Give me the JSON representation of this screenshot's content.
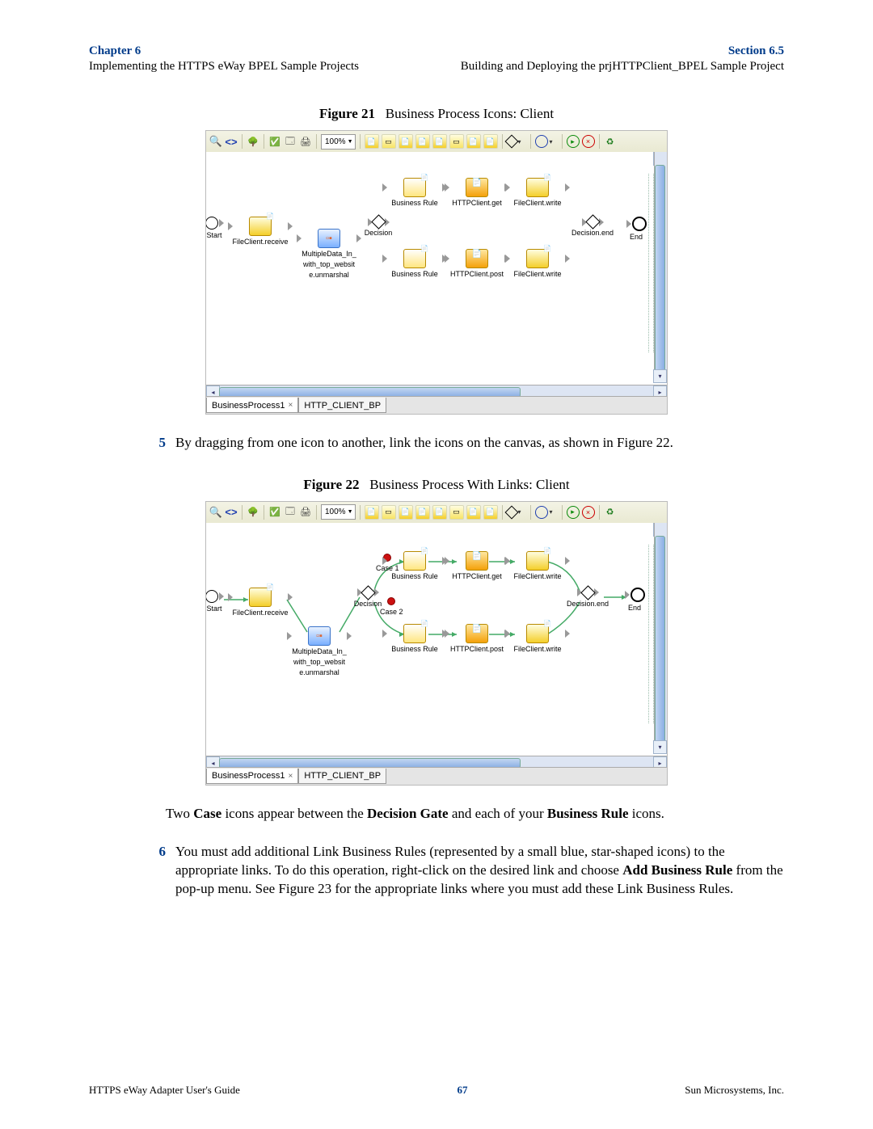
{
  "header": {
    "chapter_label": "Chapter 6",
    "chapter_sub": "Implementing the HTTPS eWay BPEL Sample Projects",
    "section_label": "Section 6.5",
    "section_sub": "Building and Deploying the prjHTTPClient_BPEL Sample Project"
  },
  "figure21": {
    "label": "Figure 21",
    "title": "Business Process Icons: Client",
    "toolbar": {
      "zoom": "100%"
    },
    "tabs": {
      "tab1": "BusinessProcess1",
      "tab2": "HTTP_CLIENT_BP"
    },
    "nodes": {
      "start": "Start",
      "fcr": "FileClient.receive",
      "multi1": "MultipleData_In_",
      "multi2": "with_top_websit",
      "multi3": "e.unmarshal",
      "decision": "Decision",
      "brule": "Business Rule",
      "httpget": "HTTPClient.get",
      "httppost": "HTTPClient.post",
      "fcw": "FileClient.write",
      "dend": "Decision.end",
      "end": "End"
    }
  },
  "para5": {
    "num": "5",
    "text": "By dragging from one icon to another, link the icons on the canvas, as shown in Figure 22."
  },
  "figure22": {
    "label": "Figure 22",
    "title": "Business Process With Links: Client",
    "toolbar": {
      "zoom": "100%"
    },
    "tabs": {
      "tab1": "BusinessProcess1",
      "tab2": "HTTP_CLIENT_BP"
    },
    "nodes": {
      "start": "Start",
      "fcr": "FileClient.receive",
      "multi1": "MultipleData_In_",
      "multi2": "with_top_websit",
      "multi3": "e.unmarshal",
      "decision": "Decision",
      "case1": "Case 1",
      "case2": "Case 2",
      "brule": "Business Rule",
      "httpget": "HTTPClient.get",
      "httppost": "HTTPClient.post",
      "fcw": "FileClient.write",
      "dend": "Decision.end",
      "end": "End"
    }
  },
  "para_cases_a": "Two ",
  "para_cases_b": "Case",
  "para_cases_c": " icons appear between the ",
  "para_cases_d": "Decision Gate",
  "para_cases_e": " and each of your ",
  "para_cases_f": "Business Rule",
  "para_cases_g": " icons.",
  "para6": {
    "num": "6",
    "text_a": "You must add additional Link Business Rules (represented by a small blue, star-shaped icons) to the appropriate links. To do this operation, right-click on the desired link and choose ",
    "bold": "Add Business Rule",
    "text_b": " from the pop-up menu. See Figure 23 for the appropriate links where you must add these Link Business Rules."
  },
  "footer": {
    "left": "HTTPS eWay Adapter User's Guide",
    "page": "67",
    "right": "Sun Microsystems, Inc."
  }
}
